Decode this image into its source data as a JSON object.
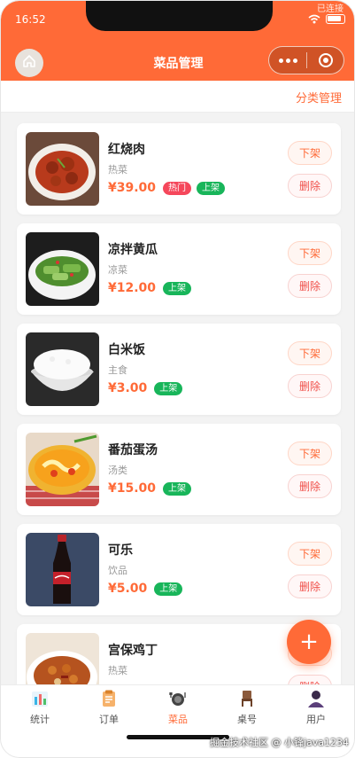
{
  "status": {
    "time": "16:52",
    "corner_text": "已连接"
  },
  "nav": {
    "title": "菜品管理"
  },
  "subbar": {
    "category_link": "分类管理"
  },
  "buttons": {
    "off_shelf": "下架",
    "delete": "删除",
    "add": "+"
  },
  "dishes": [
    {
      "name": "红烧肉",
      "category": "热菜",
      "price": "¥39.00",
      "tags": [
        "热门",
        "上架"
      ]
    },
    {
      "name": "凉拌黄瓜",
      "category": "凉菜",
      "price": "¥12.00",
      "tags": [
        "上架"
      ]
    },
    {
      "name": "白米饭",
      "category": "主食",
      "price": "¥3.00",
      "tags": [
        "上架"
      ]
    },
    {
      "name": "番茄蛋汤",
      "category": "汤类",
      "price": "¥15.00",
      "tags": [
        "上架"
      ]
    },
    {
      "name": "可乐",
      "category": "饮品",
      "price": "¥5.00",
      "tags": [
        "上架"
      ]
    },
    {
      "name": "宫保鸡丁",
      "category": "热菜",
      "price": "",
      "tags": []
    }
  ],
  "tabs": [
    {
      "label": "统计",
      "icon": "bar-chart-icon"
    },
    {
      "label": "订单",
      "icon": "clipboard-icon"
    },
    {
      "label": "菜品",
      "icon": "dish-icon",
      "active": true
    },
    {
      "label": "桌号",
      "icon": "chair-icon"
    },
    {
      "label": "用户",
      "icon": "user-icon"
    }
  ],
  "watermark": "掘金技术社区 @ 小锋java1234",
  "colors": {
    "accent": "#ff6a37",
    "hot_tag": "#f5475b",
    "on_tag": "#18b55a"
  }
}
